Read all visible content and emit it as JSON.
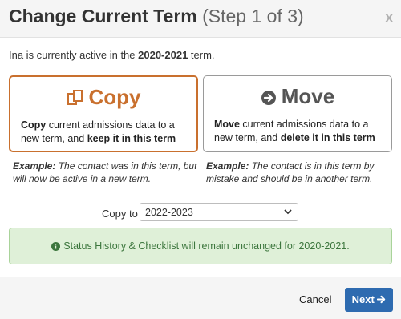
{
  "dialog": {
    "title_main": "Change Current Term",
    "title_step": "(Step 1 of 3)",
    "close_label": "x"
  },
  "intro": {
    "before": "Ina is currently active in the ",
    "term": "2020-2021",
    "after": " term."
  },
  "options": {
    "copy": {
      "title": "Copy",
      "desc_lead": "Copy",
      "desc_mid": " current admissions data to a new term, and ",
      "desc_emph": "keep it in this term",
      "example_label": "Example:",
      "example_text": " The contact was in this term, but will now be active in a new term.",
      "icon": "copy-icon"
    },
    "move": {
      "title": "Move",
      "desc_lead": "Move",
      "desc_mid": " current admissions data to a new term, and ",
      "desc_emph": "delete it in this term",
      "example_label": "Example:",
      "example_text": " The contact is in this term by mistake and should be in another term.",
      "icon": "arrow-circle-right-icon"
    }
  },
  "copy_to": {
    "label": "Copy to",
    "selected": "2022-2023"
  },
  "alert": {
    "text": "Status History & Checklist will remain unchanged for 2020-2021.",
    "icon": "info-circle-icon"
  },
  "footer": {
    "cancel": "Cancel",
    "next": "Next"
  },
  "colors": {
    "copy_accent": "#c9702e",
    "move_accent": "#555555",
    "primary": "#2e6bb0",
    "alert_bg": "#dff0d8",
    "alert_text": "#3c763d"
  }
}
